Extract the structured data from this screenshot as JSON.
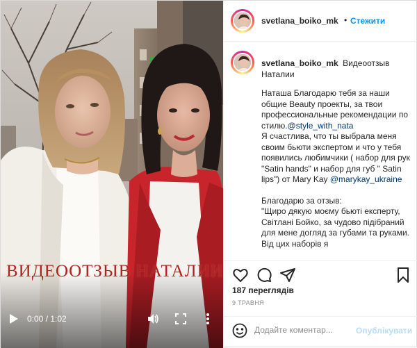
{
  "post": {
    "author": "svetlana_boiko_mk",
    "header": {
      "separator": "•",
      "follow_label": "Стежити"
    },
    "video": {
      "overlay_title": "ВИДЕООТЗЫВ НАТАЛИИ",
      "time_display": "0:00 / 1:02",
      "state": "paused"
    },
    "caption": {
      "title": "Видеоотзыв Наталии",
      "text_1": "Наташа Благодарю тебя за наши общие Beauty проекты, за твои профессиональные рекомендации по стилю.",
      "mention_1": "@style_with_nata",
      "text_2": "Я счастлива, что ты выбрала меня своим бьюти экспертом и что у тебя появились любимчики ( набор для рук \"Satin hands\" и набор для губ \" Satin lips\") от Mary Kay",
      "mention_2": "@marykay_ukraine",
      "text_3": "Благодарю за отзыв:",
      "text_4": "\"Щиро дякую моєму бьюті експерту, Світлані Бойко, за чудово підібраний для мене догляд за губами та руками. Від цих наборів я"
    },
    "stats": {
      "views": "187 переглядів",
      "date": "9 ТРАВНЯ"
    },
    "comment": {
      "placeholder": "Додайте коментар...",
      "publish_label": "Опублікувати"
    }
  },
  "icons": {
    "like": "heart-icon",
    "comment": "comment-icon",
    "share": "paper-plane-icon",
    "save": "bookmark-icon",
    "emoji": "smiley-icon",
    "play": "play-icon",
    "volume": "volume-icon",
    "fullscreen": "fullscreen-icon",
    "more": "more-vertical-icon"
  },
  "colors": {
    "accent_blue": "#0095f6",
    "link_blue": "#00376b",
    "publish_disabled": "#b2dffc",
    "overlay_text": "#b3201d",
    "muted_text": "#8e8e8e"
  }
}
